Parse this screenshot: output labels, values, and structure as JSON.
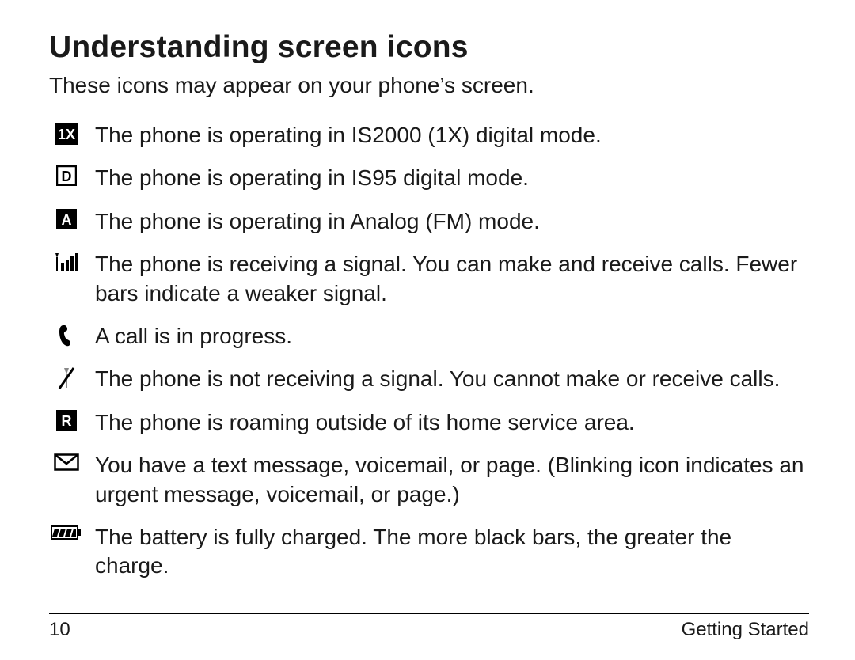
{
  "heading": "Understanding screen icons",
  "intro": "These icons may appear on your phone’s screen.",
  "items": [
    {
      "icon": "one-x-icon",
      "desc": "The phone is operating in IS2000 (1X) digital mode."
    },
    {
      "icon": "d-mode-icon",
      "desc": "The phone is operating in IS95 digital mode."
    },
    {
      "icon": "a-mode-icon",
      "desc": "The phone is operating in Analog (FM) mode."
    },
    {
      "icon": "signal-icon",
      "desc": "The phone is receiving a signal. You can make and receive calls. Fewer bars indicate a weaker signal."
    },
    {
      "icon": "call-icon",
      "desc": "A call is in progress."
    },
    {
      "icon": "no-signal-icon",
      "desc": "The phone is not receiving a signal. You cannot make or receive calls."
    },
    {
      "icon": "roaming-icon",
      "desc": "The phone is roaming outside of its home service area."
    },
    {
      "icon": "message-icon",
      "desc": "You have a text message, voicemail, or page. (Blinking icon indicates an urgent message, voicemail, or page.)"
    },
    {
      "icon": "battery-icon",
      "desc": "The battery is fully charged. The more black bars, the greater the charge."
    }
  ],
  "footer": {
    "page_number": "10",
    "section": "Getting Started"
  }
}
